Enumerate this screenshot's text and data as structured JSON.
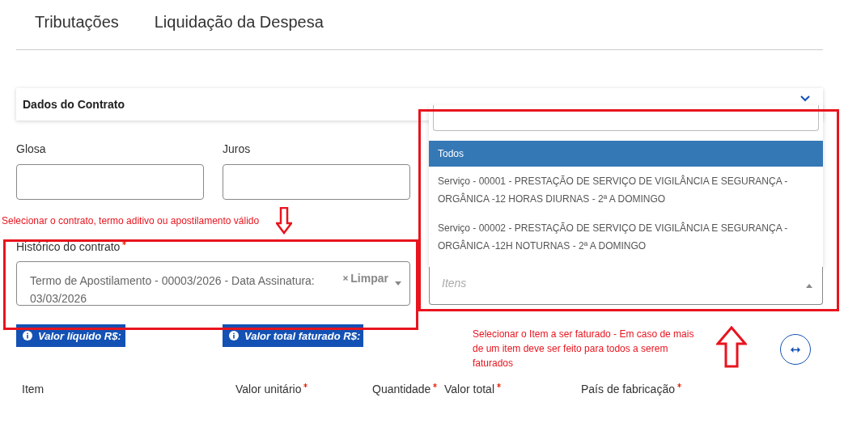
{
  "tabs": [
    {
      "label": "Tributações"
    },
    {
      "label": "Liquidação da Despesa"
    }
  ],
  "section": {
    "title": "Dados do Contrato",
    "expanded": true
  },
  "fields": [
    {
      "label": "Glosa"
    },
    {
      "label": "Juros"
    }
  ],
  "contract_history": {
    "label": "Histórico do contrato",
    "required": true,
    "value": "Termo de Apostilamento - 00003/2026 - Data Assinatura: 03/03/2026",
    "clear": "Limpar"
  },
  "items_select": {
    "placeholder": "Itens",
    "open": true,
    "options": [
      {
        "label": "Todos",
        "selected": true
      },
      {
        "label": "Serviço - 00001 - PRESTAÇÃO DE SERVIÇO DE VIGILÂNCIA E SEGURANÇA - ORGÂNICA -12 HORAS DIURNAS - 2ª A DOMINGO",
        "selected": false
      },
      {
        "label": "Serviço - 00002 - PRESTAÇÃO DE SERVIÇO DE VIGILÂNCIA E SEGURANÇA - ORGÂNICA -12H NOTURNAS - 2ª A DOMINGO",
        "selected": false
      }
    ]
  },
  "badges": [
    {
      "label": "Valor líquido R$:"
    },
    {
      "label": "Valor total faturado R$:"
    }
  ],
  "table": {
    "columns": [
      {
        "label": "Item",
        "required": false
      },
      {
        "label": "Valor unitário",
        "required": true
      },
      {
        "label": "Quantidade",
        "required": true
      },
      {
        "label": "Valor total",
        "required": true
      },
      {
        "label": "País de fabricação",
        "required": true
      }
    ]
  },
  "annotations": [
    {
      "text": "Selecionar o contrato, termo aditivo ou apostilamento válido"
    },
    {
      "text": "Selecionar o Item a ser faturado - Em caso de mais de um item deve ser feito para todos a serem faturados"
    }
  ]
}
